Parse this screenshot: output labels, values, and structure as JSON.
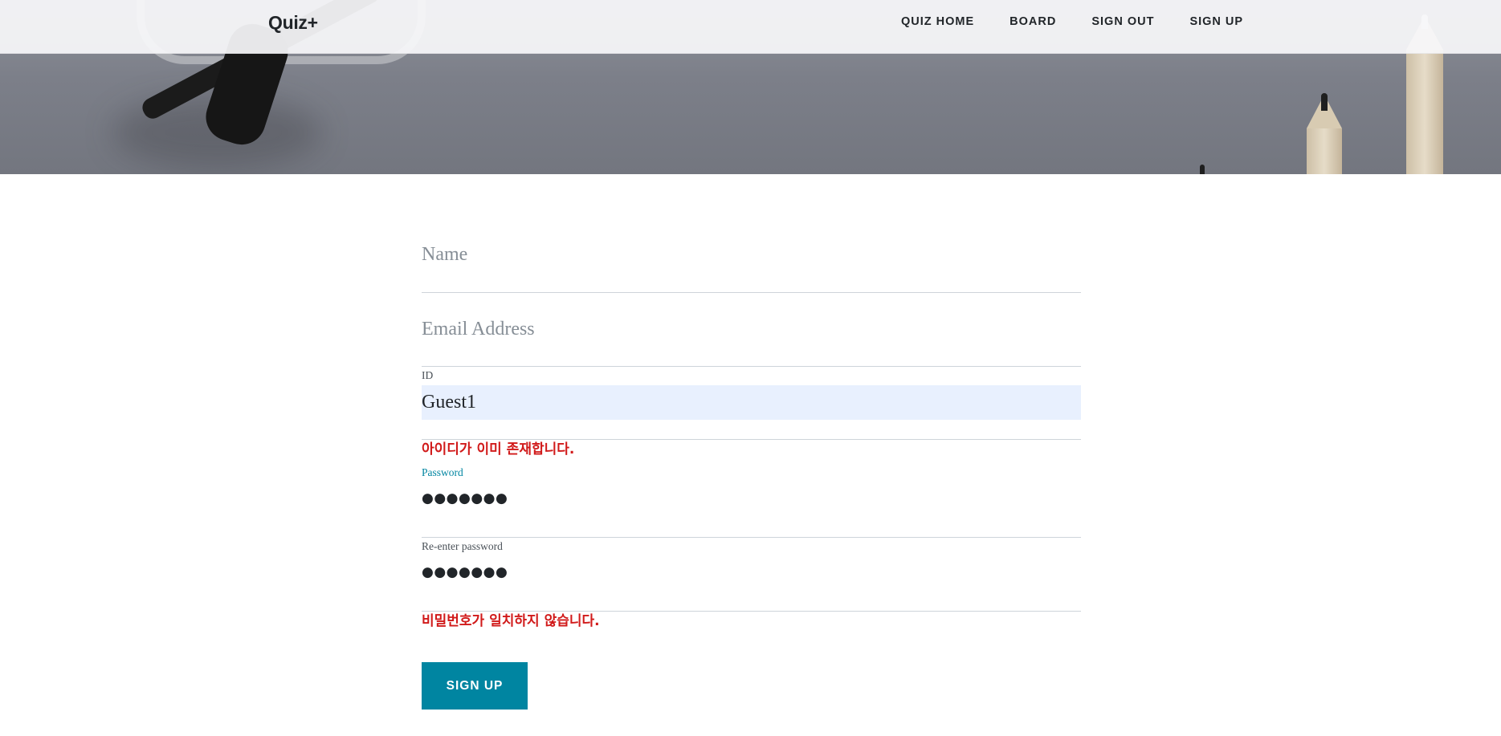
{
  "navbar": {
    "brand": "Quiz+",
    "links": [
      "QUIZ HOME",
      "BOARD",
      "SIGN OUT",
      "SIGN UP"
    ]
  },
  "form": {
    "name": {
      "placeholder": "Name",
      "value": ""
    },
    "email": {
      "placeholder": "Email Address",
      "value": ""
    },
    "id": {
      "label": "ID",
      "value": "Guest1",
      "error": "아이디가 이미 존재합니다."
    },
    "password": {
      "label": "Password",
      "value": "●●●●●●●"
    },
    "password_confirm": {
      "label": "Re-enter password",
      "value": "●●●●●●●",
      "error": "비밀번호가 일치하지 않습니다."
    },
    "submit_label": "SIGN UP"
  },
  "colors": {
    "accent": "#0085a1",
    "error": "#d11a1a",
    "autofill": "#e8f0fe"
  }
}
